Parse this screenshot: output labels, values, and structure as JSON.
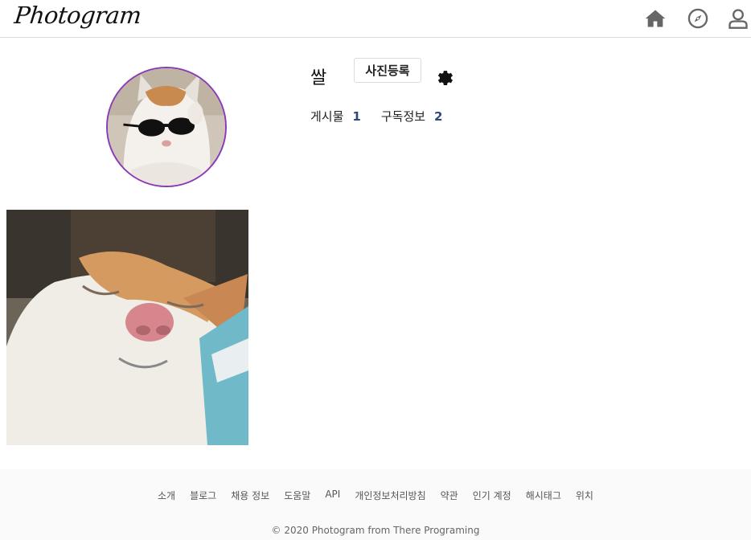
{
  "header": {
    "logo": "Photogram",
    "icons": [
      "home-icon",
      "compass-icon",
      "user-icon"
    ]
  },
  "profile": {
    "username": "쌀",
    "upload_button": "사진등록",
    "stats": [
      {
        "label": "게시물",
        "count": "1"
      },
      {
        "label": "구독정보",
        "count": "2"
      }
    ]
  },
  "colors": {
    "avatar_ring": "#8a3ab9",
    "stat_count": "#2e4a78",
    "icon_gray": "#666666"
  },
  "footer": {
    "links": [
      "소개",
      "블로그",
      "채용 정보",
      "도움말",
      "API",
      "개인정보처리방침",
      "약관",
      "인기 계정",
      "해시태그",
      "위치"
    ],
    "copyright": "© 2020 Photogram from There Programing"
  }
}
